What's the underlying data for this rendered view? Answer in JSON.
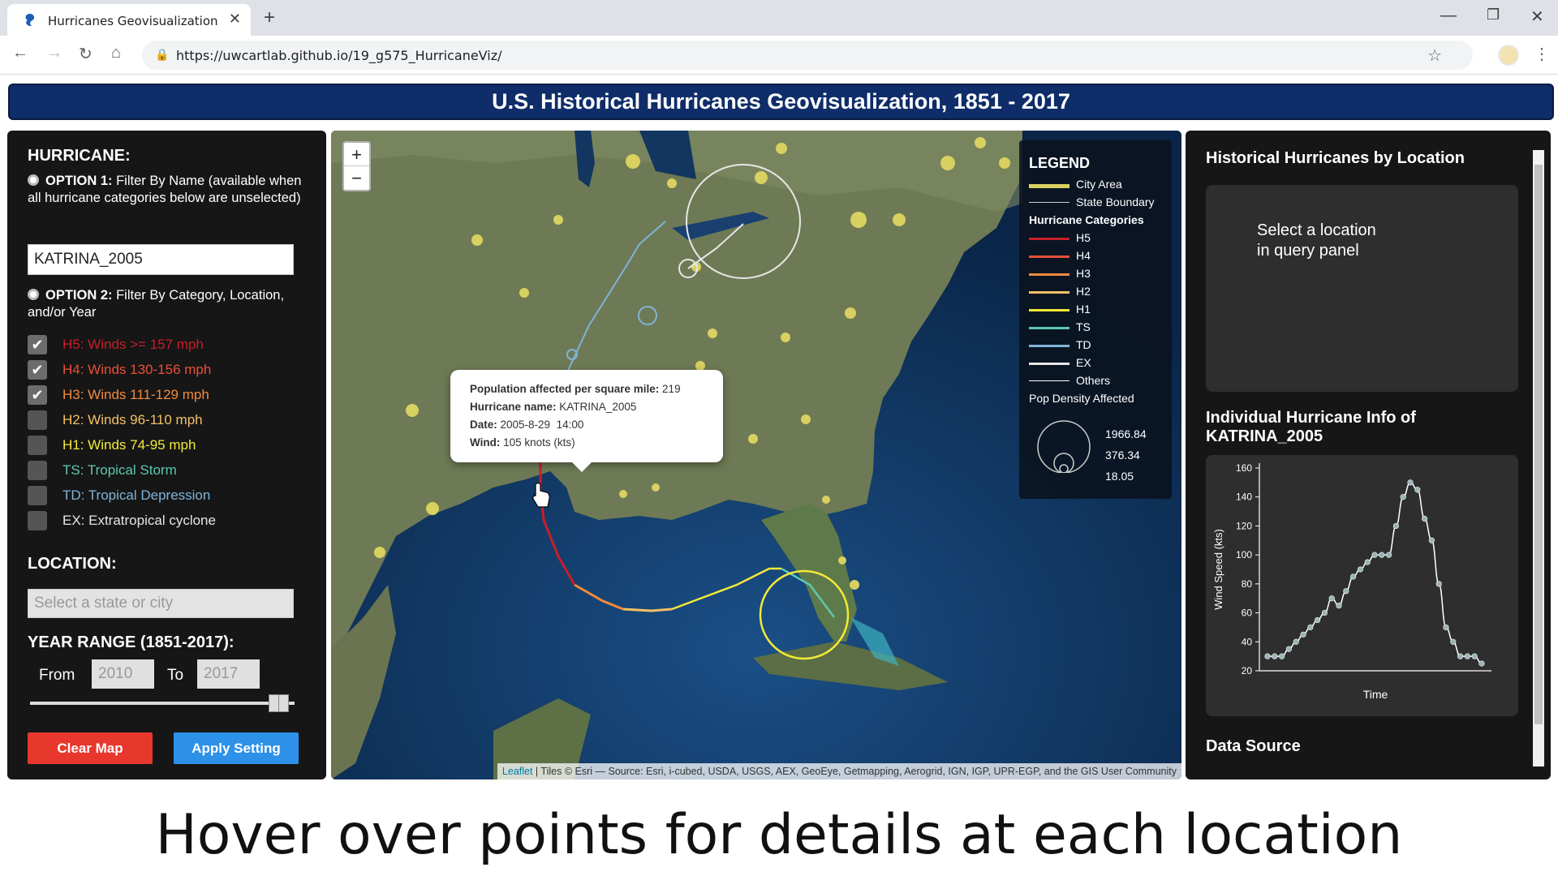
{
  "browser": {
    "tab_title": "Hurricanes Geovisualization",
    "url": "https://uwcartlab.github.io/19_g575_HurricaneViz/"
  },
  "page_title": "U.S. Historical Hurricanes Geovisualization, 1851 - 2017",
  "query_panel": {
    "heading": "HURRICANE:",
    "option1_label": "OPTION 1:",
    "option1_text": " Filter By Name (available when all hurricane categories below are unselected)",
    "name_value": "KATRINA_2005",
    "option2_label": "OPTION 2:",
    "option2_text": " Filter By Category, Location, and/or Year",
    "categories": [
      {
        "label": "H5: Winds >= 157 mph",
        "checked": true,
        "color": "#c81e2a"
      },
      {
        "label": "H4: Winds 130-156 mph",
        "checked": true,
        "color": "#e8503a"
      },
      {
        "label": "H3: Winds 111-129 mph",
        "checked": true,
        "color": "#f28a3c"
      },
      {
        "label": "H2: Winds 96-110 mph",
        "checked": false,
        "color": "#f5c064"
      },
      {
        "label": "H1: Winds 74-95 mph",
        "checked": false,
        "color": "#f2ea38"
      },
      {
        "label": "TS: Tropical Storm",
        "checked": false,
        "color": "#5ec8b0"
      },
      {
        "label": "TD: Tropical Depression",
        "checked": false,
        "color": "#7fb4d8"
      },
      {
        "label": "EX: Extratropical cyclone",
        "checked": false,
        "color": "#e6e6e6"
      }
    ],
    "location_heading": "LOCATION:",
    "location_placeholder": "Select a state or city",
    "year_heading": "YEAR RANGE (1851-2017):",
    "from_label": "From",
    "from_value": "2010",
    "to_label": "To",
    "to_value": "2017",
    "clear_button": "Clear Map",
    "apply_button": "Apply Setting"
  },
  "map": {
    "zoom_in": "+",
    "zoom_out": "−",
    "legend": {
      "title": "LEGEND",
      "items": [
        {
          "label": "City Area",
          "color": "#d8d060"
        },
        {
          "label": "State Boundary",
          "color": "#cccccc"
        }
      ],
      "categories_title": "Hurricane Categories",
      "categories": [
        {
          "label": "H5",
          "color": "#c81e2a"
        },
        {
          "label": "H4",
          "color": "#e8503a"
        },
        {
          "label": "H3",
          "color": "#f28a3c"
        },
        {
          "label": "H2",
          "color": "#f5c064"
        },
        {
          "label": "H1",
          "color": "#f2ea38"
        },
        {
          "label": "TS",
          "color": "#5ec8b0"
        },
        {
          "label": "TD",
          "color": "#7fb4d8"
        },
        {
          "label": "EX",
          "color": "#e6e6e6"
        },
        {
          "label": "Others",
          "color": "#ffffff"
        }
      ],
      "pop_title": "Pop Density Affected",
      "pop_values": [
        "1966.84",
        "376.34",
        "18.05"
      ]
    },
    "popup": {
      "pop_label": "Population affected per square mile:",
      "pop_value": " 219",
      "name_label": "Hurricane name:",
      "name_value": " KATRINA_2005",
      "date_label": "Date:",
      "date_value": " 2005-8-29  14:00",
      "wind_label": "Wind:",
      "wind_value": " 105 knots (kts)"
    },
    "attribution_link": "Leaflet",
    "attribution_text": " | Tiles © Esri — Source: Esri, i-cubed, USDA, USGS, AEX, GeoEye, Getmapping, Aerogrid, IGN, IGP, UPR-EGP, and the GIS User Community"
  },
  "info_panel": {
    "location_heading": "Historical Hurricanes by Location",
    "location_placeholder_line1": "Select a location",
    "location_placeholder_line2": "in query panel",
    "individual_heading_line1": "Individual Hurricane Info of",
    "individual_heading_line2": "KATRINA_2005",
    "data_source_heading": "Data Source"
  },
  "chart_data": {
    "type": "line",
    "xlabel": "Time",
    "ylabel": "Wind Speed (kts)",
    "ylim": [
      20,
      160
    ],
    "yticks": [
      20,
      40,
      60,
      80,
      100,
      120,
      140,
      160
    ],
    "series": [
      {
        "values": [
          30,
          30,
          30,
          35,
          40,
          45,
          50,
          55,
          60,
          70,
          65,
          75,
          85,
          90,
          95,
          100,
          100,
          100,
          120,
          140,
          150,
          145,
          125,
          110,
          80,
          50,
          40,
          30,
          30,
          30,
          25
        ]
      }
    ]
  },
  "caption": "Hover over points for details at each location"
}
